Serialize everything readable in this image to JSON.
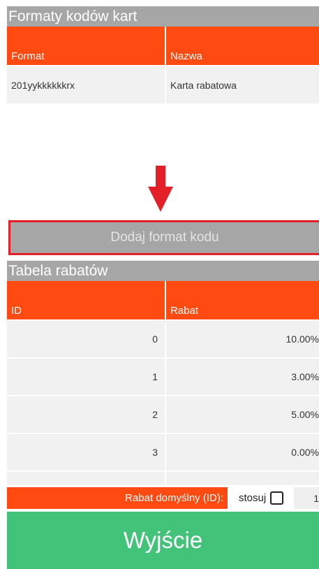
{
  "formats": {
    "title": "Formaty kodów kart",
    "columns": [
      "Format",
      "Nazwa"
    ],
    "rows": [
      {
        "format": "201yykkkkkkrx",
        "name": "Karta rabatowa"
      }
    ],
    "add_button_label": "Dodaj format kodu"
  },
  "discounts": {
    "title": "Tabela rabatów",
    "columns": [
      "ID",
      "Rabat"
    ],
    "rows": [
      {
        "id": "0",
        "rabat": "10.00%"
      },
      {
        "id": "1",
        "rabat": "3.00%"
      },
      {
        "id": "2",
        "rabat": "5.00%"
      },
      {
        "id": "3",
        "rabat": "0.00%"
      }
    ]
  },
  "default_discount": {
    "label": "Rabat domyślny (ID):",
    "apply_label": "stosuj",
    "apply_checked": false,
    "value": "1"
  },
  "exit_button_label": "Wyjście",
  "colors": {
    "header_gray": "#a6a6a6",
    "accent_orange": "#ff4a12",
    "arrow_red": "#e32027",
    "exit_green": "#43c27a"
  },
  "icons": {
    "annotation": "arrow-down-icon"
  }
}
